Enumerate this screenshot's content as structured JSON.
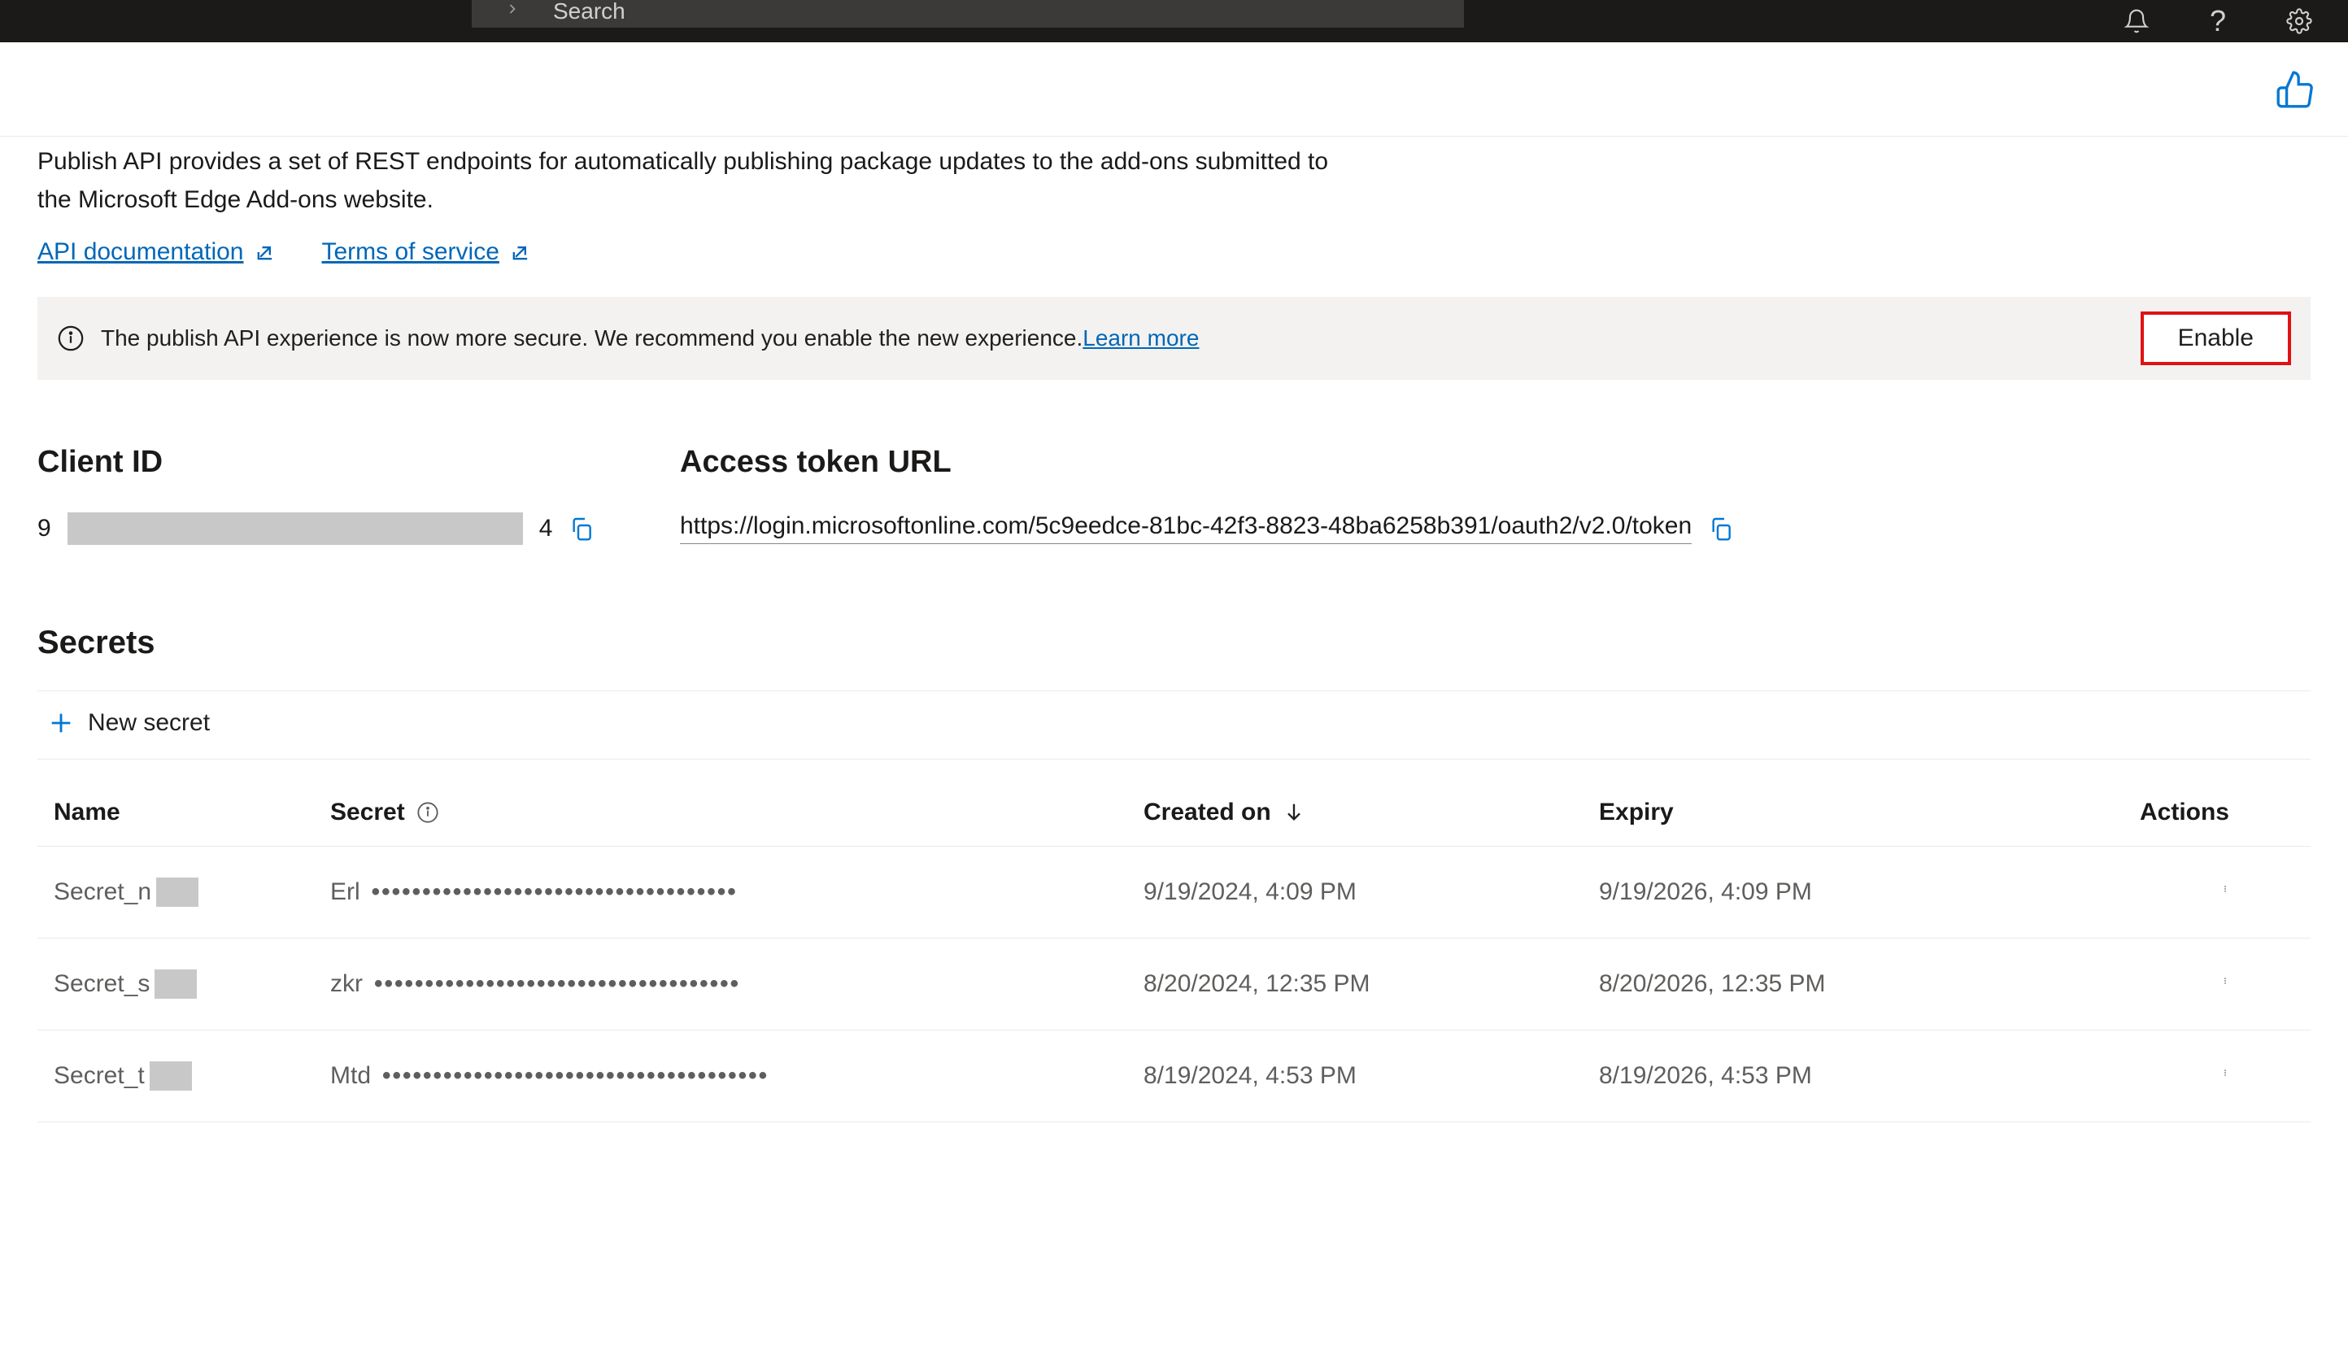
{
  "header": {
    "search_placeholder": "Search"
  },
  "intro": {
    "text": "Publish API provides a set of REST endpoints for automatically publishing package updates to the add-ons submitted to the Microsoft Edge Add-ons website.",
    "api_doc_label": "API documentation",
    "tos_label": "Terms of service"
  },
  "banner": {
    "text": "The publish API experience is now more secure. We recommend you enable the new experience. ",
    "learn_more_label": "Learn more",
    "enable_label": "Enable"
  },
  "client": {
    "heading": "Client ID",
    "prefix": "9",
    "suffix": "4"
  },
  "token": {
    "heading": "Access token URL",
    "url": "https://login.microsoftonline.com/5c9eedce-81bc-42f3-8823-48ba6258b391/oauth2/v2.0/token"
  },
  "secrets": {
    "heading": "Secrets",
    "new_label": "New secret",
    "columns": {
      "name": "Name",
      "secret": "Secret",
      "created": "Created on",
      "expiry": "Expiry",
      "actions": "Actions"
    },
    "rows": [
      {
        "name_prefix": "Secret_n",
        "secret_prefix": "Erl",
        "secret_dots": "••••••••••••••••••••••••••••••••••••",
        "created": "9/19/2024, 4:09 PM",
        "expiry": "9/19/2026, 4:09 PM"
      },
      {
        "name_prefix": "Secret_s",
        "secret_prefix": "zkr",
        "secret_dots": "••••••••••••••••••••••••••••••••••••",
        "created": "8/20/2024, 12:35 PM",
        "expiry": "8/20/2026, 12:35 PM"
      },
      {
        "name_prefix": "Secret_t",
        "secret_prefix": "Mtd",
        "secret_dots": "••••••••••••••••••••••••••••••••••••••",
        "created": "8/19/2024, 4:53 PM",
        "expiry": "8/19/2026, 4:53 PM"
      }
    ]
  }
}
